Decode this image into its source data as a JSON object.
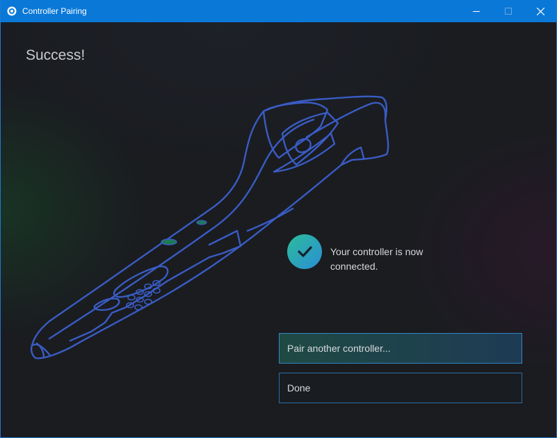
{
  "window": {
    "title": "Controller Pairing",
    "app_icon": "steam-gear-icon"
  },
  "titlebar_controls": [
    "minimize-icon",
    "maximize-icon",
    "close-icon"
  ],
  "heading": "Success!",
  "status": {
    "icon": "check-circle-icon",
    "text": "Your controller is now connected."
  },
  "buttons": {
    "pair_another": "Pair another controller...",
    "done": "Done"
  },
  "colors": {
    "titlebar": "#0a78d7",
    "outline": "#3a5cc4",
    "accent_green": "#2dbb9a",
    "accent_blue": "#2a8fd6"
  }
}
